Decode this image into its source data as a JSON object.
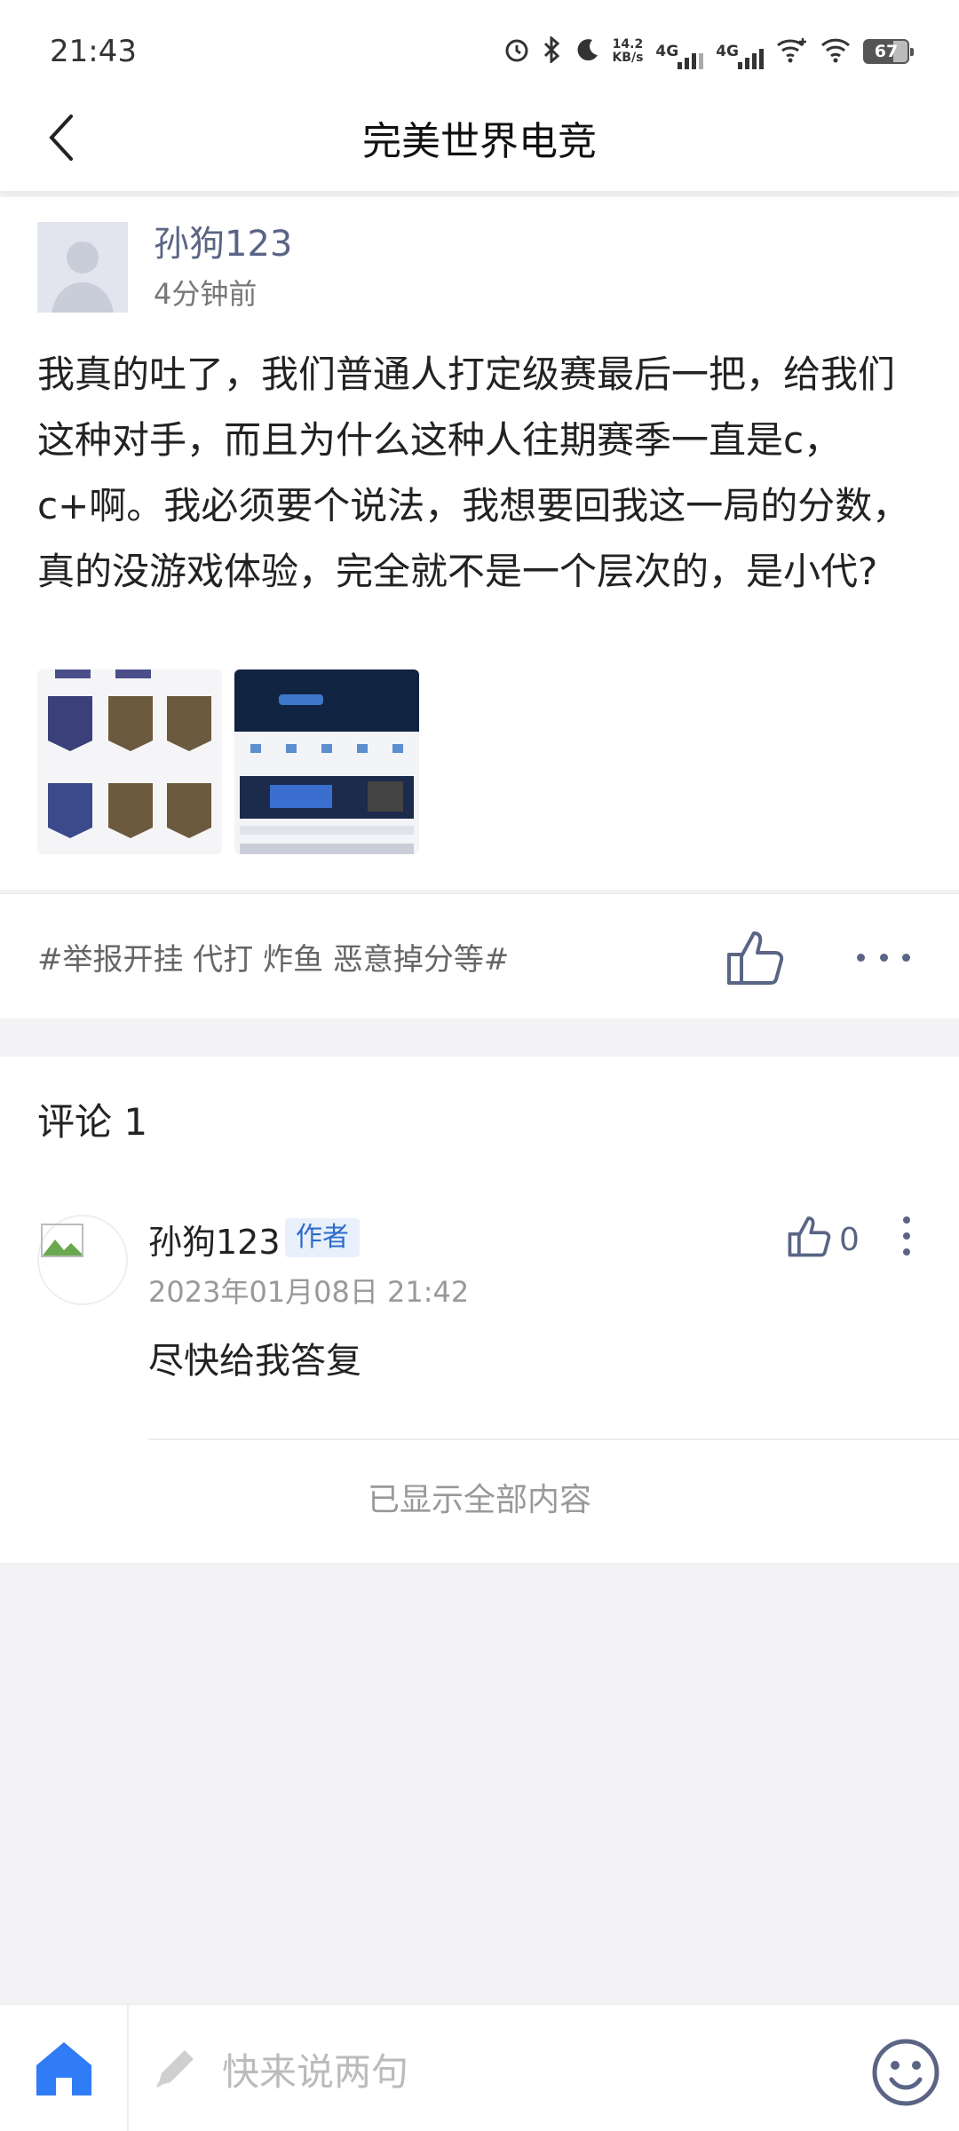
{
  "status_bar": {
    "time": "21:43",
    "net_speed_value": "14.2",
    "net_speed_unit": "KB/s",
    "network1": "4G",
    "network2": "4G",
    "battery": "67"
  },
  "header": {
    "title": "完美世界电竞"
  },
  "post": {
    "author": "孙狗123",
    "time": "4分钟前",
    "body": "我真的吐了，我们普通人打定级赛最后一把，给我们这种对手，而且为什么这种人往期赛季一直是c，c+啊。我必须要个说法，我想要回我这一局的分数，真的没游戏体验，完全就不是一个层次的，是小代?",
    "hashtag": "#举报开挂 代打 炸鱼 恶意掉分等#"
  },
  "comments": {
    "title": "评论 1",
    "items": [
      {
        "author": "孙狗123",
        "badge": "作者",
        "date": "2023年01月08日 21:42",
        "text": "尽快给我答复",
        "likes": "0"
      }
    ],
    "end_text": "已显示全部内容"
  },
  "bottom_bar": {
    "input_placeholder": "快来说两句"
  },
  "colors": {
    "accent_blue": "#2f6bc9",
    "home_blue": "#2f7cf6",
    "icon_gray": "#5a6585"
  }
}
